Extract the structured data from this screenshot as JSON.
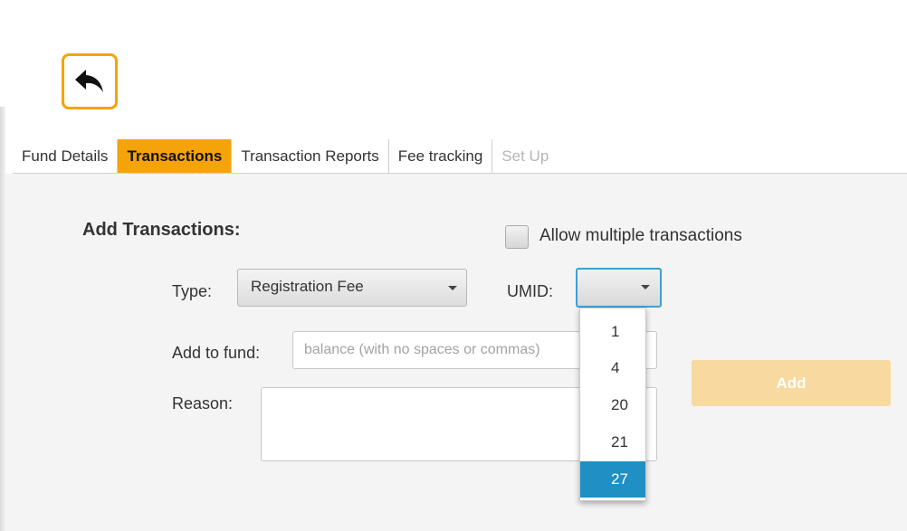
{
  "back_button": {
    "icon": "reply-arrow-icon"
  },
  "tabs": [
    {
      "label": "Fund Details",
      "state": "normal"
    },
    {
      "label": "Transactions",
      "state": "active"
    },
    {
      "label": "Transaction Reports",
      "state": "normal"
    },
    {
      "label": "Fee tracking",
      "state": "normal"
    },
    {
      "label": "Set Up",
      "state": "disabled"
    }
  ],
  "form": {
    "title": "Add Transactions:",
    "allow_multiple_label": "Allow multiple transactions",
    "type_label": "Type:",
    "type_value": "Registration Fee",
    "umid_label": "UMID:",
    "umid_value": "",
    "add_to_fund_label": "Add to fund:",
    "add_to_fund_placeholder": "balance (with no spaces or commas)",
    "reason_label": "Reason:",
    "add_button_label": "Add"
  },
  "umid_dropdown": {
    "options": [
      "1",
      "4",
      "20",
      "21",
      "27"
    ],
    "highlighted": "27"
  },
  "colors": {
    "accent": "#f5a30b",
    "add_button_disabled": "#f8d9a0",
    "dropdown_highlight": "#1f8fc4",
    "focus_border": "#3f9fd3"
  }
}
